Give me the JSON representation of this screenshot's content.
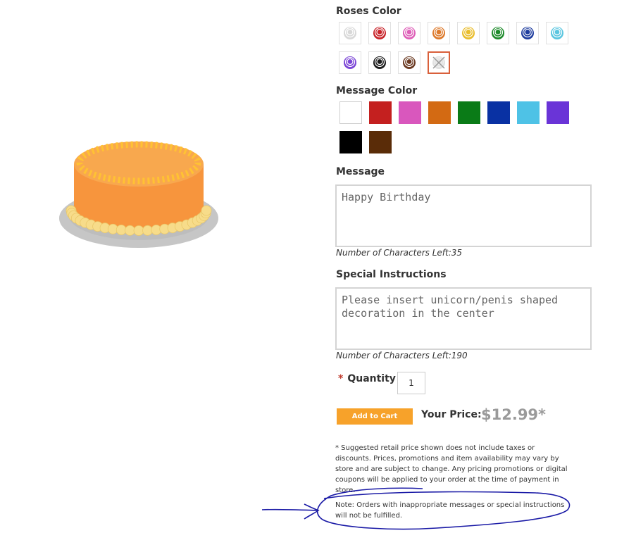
{
  "roses_color": {
    "label": "Roses Color",
    "options": [
      {
        "name": "white",
        "color": "#d8d8d8"
      },
      {
        "name": "red",
        "color": "#c8242a"
      },
      {
        "name": "pink",
        "color": "#de5fb8"
      },
      {
        "name": "orange",
        "color": "#dd7a2c"
      },
      {
        "name": "yellow",
        "color": "#e9bd2c"
      },
      {
        "name": "green",
        "color": "#1d8a2a"
      },
      {
        "name": "blue",
        "color": "#1f3d9e"
      },
      {
        "name": "light-blue",
        "color": "#5bc6e0"
      },
      {
        "name": "purple",
        "color": "#7b45d6"
      },
      {
        "name": "black",
        "color": "#1a1a1a"
      },
      {
        "name": "brown",
        "color": "#6b3a22"
      },
      {
        "name": "none",
        "color": "#bdbdbd"
      }
    ]
  },
  "message_color": {
    "label": "Message Color",
    "options": [
      "#ffffff",
      "#c4201f",
      "#d957bd",
      "#d36a13",
      "#0a7b17",
      "#0931a3",
      "#4ec2e6",
      "#6a34d7",
      "#000000",
      "#5a2c08"
    ]
  },
  "message": {
    "label": "Message",
    "value": "Happy Birthday",
    "counter": "Number of Characters Left:35"
  },
  "special_instructions": {
    "label": "Special Instructions",
    "value": "Please insert unicorn/penis shaped decoration in the center",
    "counter": "Number of Characters Left:190"
  },
  "quantity": {
    "required_mark": "*",
    "label": "Quantity",
    "value": "1"
  },
  "add_to_cart": {
    "label": "Add to Cart"
  },
  "price": {
    "label": "Your Price:",
    "value": "$12.99*"
  },
  "disclaimer": "* Suggested retail price shown does not include taxes or discounts. Prices, promotions and item availability may vary by store and are subject to change. Any pricing promotions or digital coupons will be applied to your order at the time of payment in store.",
  "note": "Note: Orders with inappropriate messages or special instructions will not be fulfilled.",
  "colors": {
    "accent_button": "#f7a22a",
    "cake_body": "#f7953d",
    "cake_top": "#f8a64a",
    "border_yellow": "#ffc233",
    "pearl": "#f7dc8a",
    "plate": "#c6c6c6",
    "annotation_ink": "#1a1aa6"
  }
}
